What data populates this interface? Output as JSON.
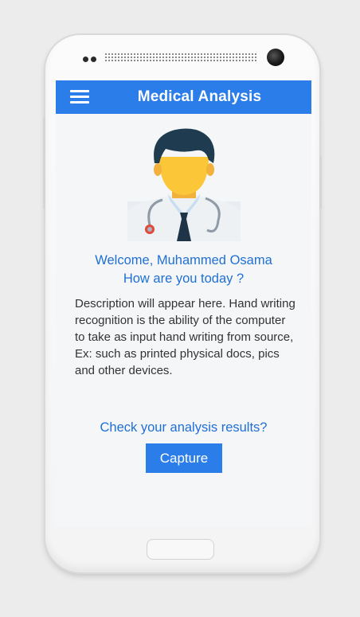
{
  "app": {
    "title": "Medical Analysis"
  },
  "icons": {
    "menu": "hamburger-menu-icon",
    "avatar": "doctor-avatar-icon"
  },
  "greeting": {
    "line1": "Welcome, Muhammed Osama",
    "line2": "How are you today ?"
  },
  "description": "Description will appear here. Hand writing recognition is the ability of the computer to take as input hand writing from source, Ex: such as printed physical docs, pics and other devices.",
  "prompt": "Check your analysis results?",
  "capture_label": "Capture",
  "colors": {
    "accent": "#2b7de9",
    "link_text": "#1f6fd6",
    "screen_bg": "#f5f6f7"
  }
}
